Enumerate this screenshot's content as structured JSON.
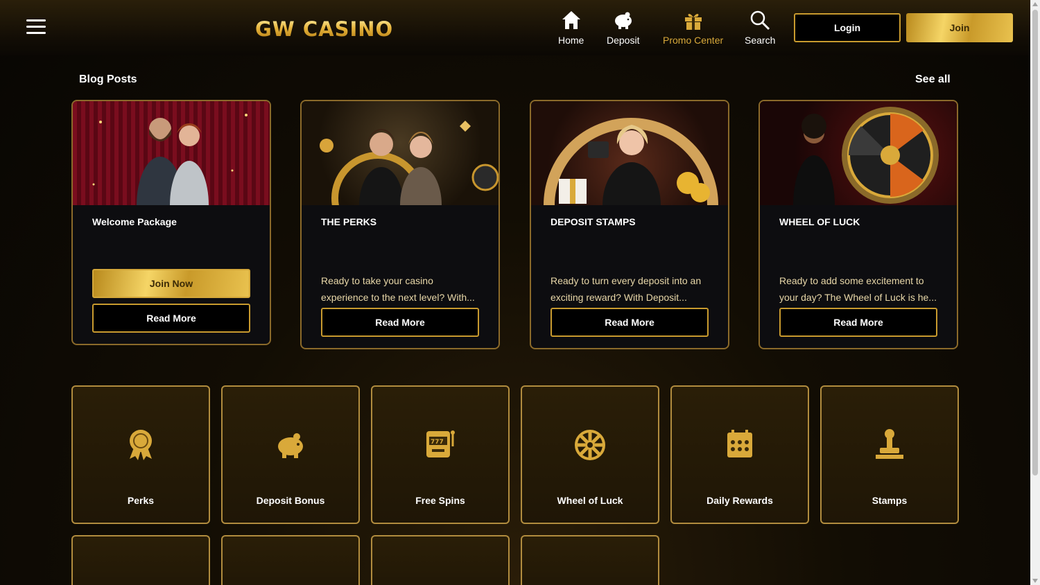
{
  "header": {
    "logo": "GW CASINO",
    "nav": [
      {
        "label": "Home",
        "icon": "home-icon"
      },
      {
        "label": "Deposit",
        "icon": "piggy-bank-icon"
      },
      {
        "label": "Promo Center",
        "icon": "gift-icon"
      },
      {
        "label": "Search",
        "icon": "search-icon"
      }
    ],
    "login_label": "Login",
    "join_label": "Join"
  },
  "blog": {
    "title": "Blog Posts",
    "see_all": "See all",
    "cards": [
      {
        "title": "Welcome Package",
        "description": "",
        "primary_button": "Join Now",
        "button": "Read More"
      },
      {
        "title": "THE PERKS",
        "description": "Ready to take your casino experience to the next level? With...",
        "button": "Read More"
      },
      {
        "title": "DEPOSIT STAMPS",
        "description": "Ready to turn every deposit into an exciting reward? With Deposit...",
        "button": "Read More"
      },
      {
        "title": "WHEEL OF LUCK",
        "description": "Ready to add some excitement to your day? The Wheel of Luck is he...",
        "button": "Read More"
      }
    ]
  },
  "promos": [
    {
      "label": "Perks",
      "icon": "medal-icon"
    },
    {
      "label": "Deposit Bonus",
      "icon": "piggy-bank-icon"
    },
    {
      "label": "Free Spins",
      "icon": "slot-machine-icon"
    },
    {
      "label": "Wheel of Luck",
      "icon": "wheel-icon"
    },
    {
      "label": "Daily Rewards",
      "icon": "calendar-icon"
    },
    {
      "label": "Stamps",
      "icon": "stamp-icon"
    }
  ],
  "colors": {
    "gold": "#d9a93a",
    "border": "#8b6a2a",
    "background": "#080603"
  }
}
